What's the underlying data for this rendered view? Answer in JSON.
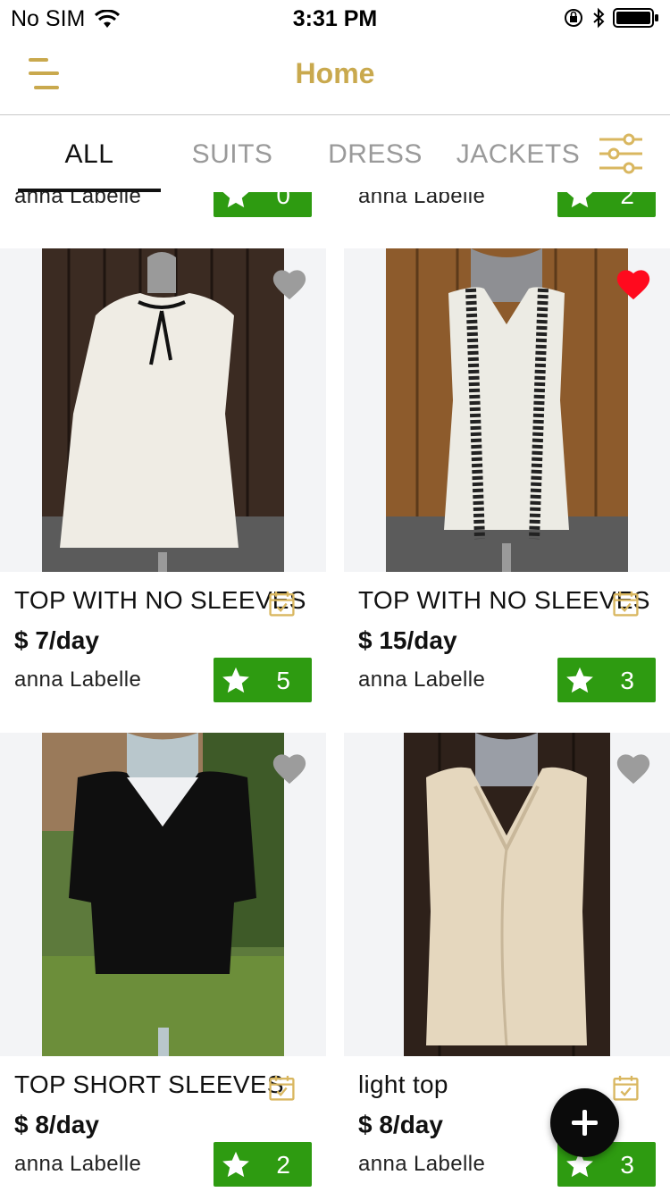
{
  "status_bar": {
    "carrier": "No SIM",
    "time": "3:31 PM",
    "icons": [
      "wifi-icon",
      "orientation-lock-icon",
      "bluetooth-icon",
      "battery-icon"
    ]
  },
  "nav": {
    "title": "Home",
    "menu_icon": "hamburger-menu-icon",
    "accent_color": "#c9a94e"
  },
  "tabs": [
    {
      "label": "ALL",
      "active": true
    },
    {
      "label": "SUITS",
      "active": false
    },
    {
      "label": "DRESS",
      "active": false
    },
    {
      "label": "JACKETS",
      "active": false
    }
  ],
  "filter_icon": "filter-sliders-icon",
  "partial_row": [
    {
      "owner": "anna Labelle",
      "rating": "0"
    },
    {
      "owner": "anna Labelle",
      "rating": "2"
    }
  ],
  "products": [
    {
      "title": "TOP WITH NO SLEEVES",
      "price": "$ 7/day",
      "owner": "anna Labelle",
      "rating": "5",
      "favorited": false
    },
    {
      "title": "TOP WITH NO SLEEVES",
      "price": "$ 15/day",
      "owner": "anna Labelle",
      "rating": "3",
      "favorited": true
    },
    {
      "title": "TOP SHORT SLEEVES",
      "price": "$ 8/day",
      "owner": "anna Labelle",
      "rating": "2",
      "favorited": false
    },
    {
      "title": "light top",
      "price": "$ 8/day",
      "owner": "anna Labelle",
      "rating": "3",
      "favorited": false
    }
  ],
  "colors": {
    "rating_green": "#2e9b11",
    "favorite_red": "#ff0a1e",
    "heart_gray": "#9c9c9c",
    "tab_inactive": "#9a9a9a"
  },
  "fab_icon": "plus-icon"
}
